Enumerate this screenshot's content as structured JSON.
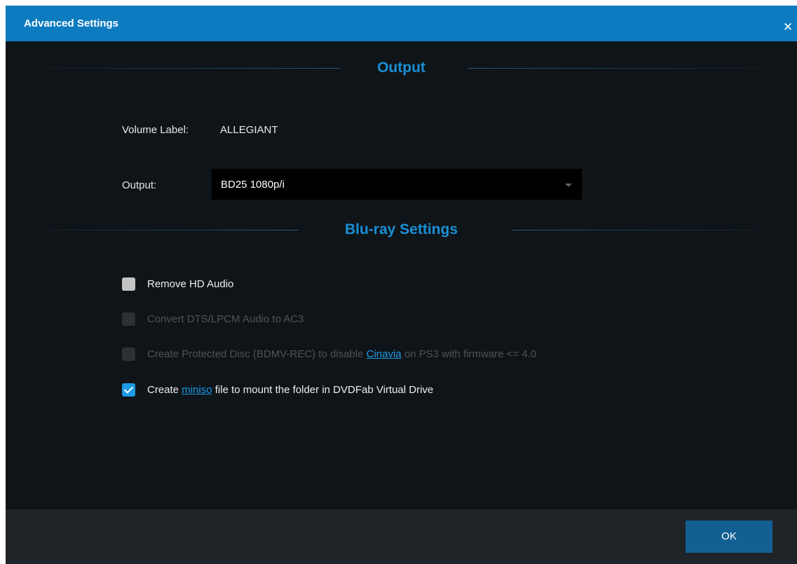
{
  "window": {
    "title": "Advanced Settings",
    "close_glyph": "✕"
  },
  "output_section": {
    "header": "Output",
    "volume_label_caption": "Volume Label:",
    "volume_label_value": "ALLEGIANT",
    "output_caption": "Output:",
    "output_selected": "BD25 1080p/i"
  },
  "bluray_section": {
    "header": "Blu-ray Settings",
    "remove_hd_audio": {
      "label": "Remove HD Audio",
      "checked": false,
      "enabled": true
    },
    "convert_dts": {
      "label": "Convert DTS/LPCM Audio to AC3",
      "checked": false,
      "enabled": false
    },
    "protected_disc": {
      "label_before": "Create Protected Disc (BDMV-REC) to disable ",
      "link": "Cinavia",
      "label_after": " on PS3 with firmware <= 4.0",
      "checked": false,
      "enabled": false
    },
    "miniso": {
      "label_before": "Create ",
      "link": "miniso",
      "label_after": " file to mount the folder in DVDFab Virtual Drive",
      "checked": true,
      "enabled": true
    }
  },
  "footer": {
    "ok_label": "OK"
  },
  "colors": {
    "titlebar": "#0d7bbf",
    "background": "#0f1418",
    "accent": "#1a8fd6",
    "footer": "#1f2428",
    "ok_button": "#135f93"
  }
}
